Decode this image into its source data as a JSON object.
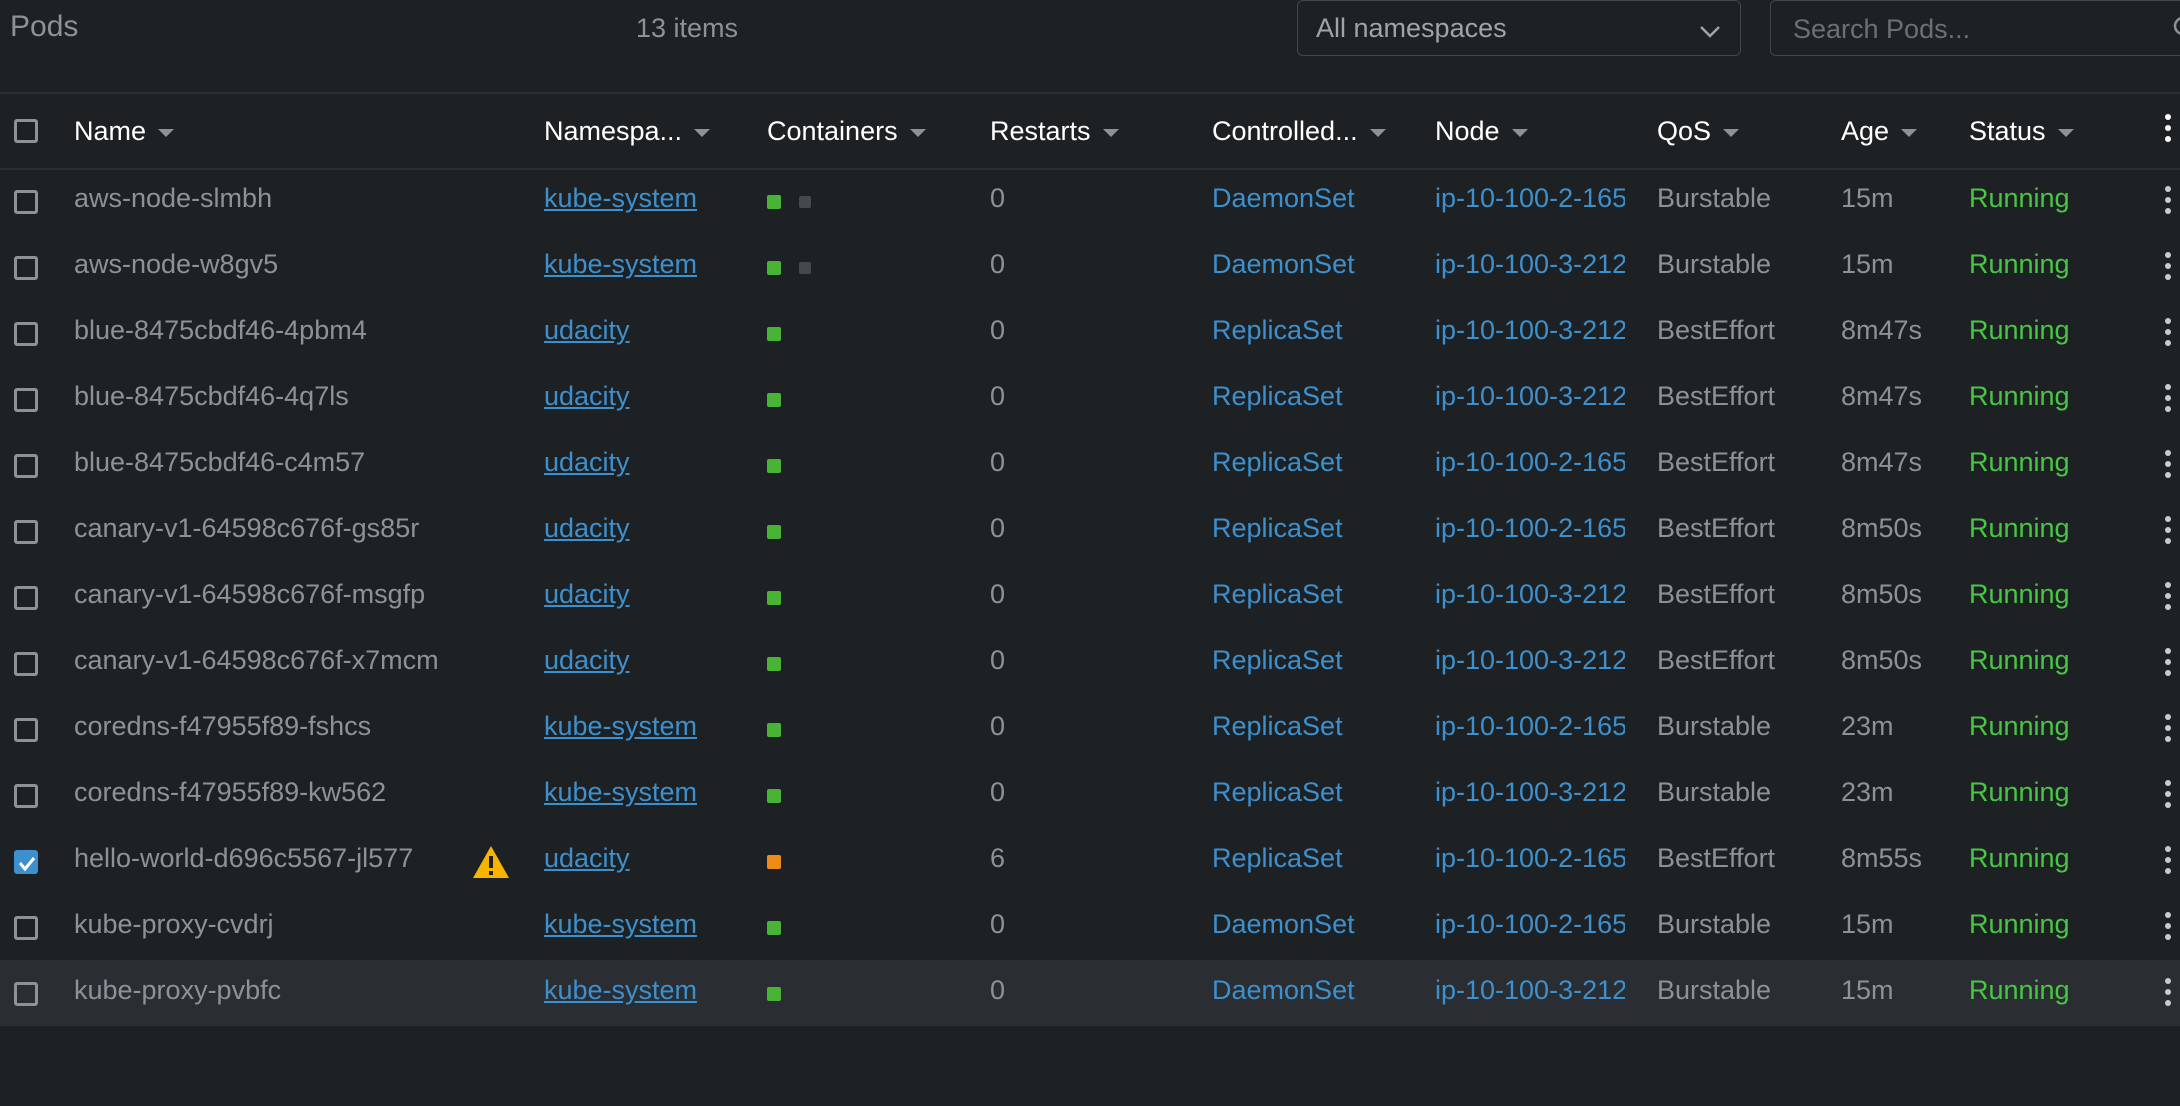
{
  "header": {
    "title": "Pods",
    "items_count": "13 items",
    "namespace_select": "All namespaces",
    "search_placeholder": "Search Pods..."
  },
  "columns": [
    "Name",
    "Namespa...",
    "Containers",
    "Restarts",
    "Controlled...",
    "Node",
    "QoS",
    "Age",
    "Status"
  ],
  "colors": {
    "background": "#1e2124",
    "link": "#3d90ce",
    "running": "#48c744",
    "container_ok": "#48b335",
    "container_gray": "#45494e",
    "container_warn": "#f18a17",
    "warning_icon": "#f7b500"
  },
  "rows": [
    {
      "name": "aws-node-slmbh",
      "namespace": "kube-system",
      "containers": [
        "green",
        "gray"
      ],
      "restarts": "0",
      "controlled_by": "DaemonSet",
      "node": "ip-10-100-2-165",
      "qos": "Burstable",
      "age": "15m",
      "status": "Running",
      "checked": false,
      "warning": false
    },
    {
      "name": "aws-node-w8gv5",
      "namespace": "kube-system",
      "containers": [
        "green",
        "gray"
      ],
      "restarts": "0",
      "controlled_by": "DaemonSet",
      "node": "ip-10-100-3-212",
      "qos": "Burstable",
      "age": "15m",
      "status": "Running",
      "checked": false,
      "warning": false
    },
    {
      "name": "blue-8475cbdf46-4pbm4",
      "namespace": "udacity",
      "containers": [
        "green"
      ],
      "restarts": "0",
      "controlled_by": "ReplicaSet",
      "node": "ip-10-100-3-212",
      "qos": "BestEffort",
      "age": "8m47s",
      "status": "Running",
      "checked": false,
      "warning": false
    },
    {
      "name": "blue-8475cbdf46-4q7ls",
      "namespace": "udacity",
      "containers": [
        "green"
      ],
      "restarts": "0",
      "controlled_by": "ReplicaSet",
      "node": "ip-10-100-3-212",
      "qos": "BestEffort",
      "age": "8m47s",
      "status": "Running",
      "checked": false,
      "warning": false
    },
    {
      "name": "blue-8475cbdf46-c4m57",
      "namespace": "udacity",
      "containers": [
        "green"
      ],
      "restarts": "0",
      "controlled_by": "ReplicaSet",
      "node": "ip-10-100-2-165",
      "qos": "BestEffort",
      "age": "8m47s",
      "status": "Running",
      "checked": false,
      "warning": false
    },
    {
      "name": "canary-v1-64598c676f-gs85r",
      "namespace": "udacity",
      "containers": [
        "green"
      ],
      "restarts": "0",
      "controlled_by": "ReplicaSet",
      "node": "ip-10-100-2-165",
      "qos": "BestEffort",
      "age": "8m50s",
      "status": "Running",
      "checked": false,
      "warning": false
    },
    {
      "name": "canary-v1-64598c676f-msgfp",
      "namespace": "udacity",
      "containers": [
        "green"
      ],
      "restarts": "0",
      "controlled_by": "ReplicaSet",
      "node": "ip-10-100-3-212",
      "qos": "BestEffort",
      "age": "8m50s",
      "status": "Running",
      "checked": false,
      "warning": false
    },
    {
      "name": "canary-v1-64598c676f-x7mcm",
      "namespace": "udacity",
      "containers": [
        "green"
      ],
      "restarts": "0",
      "controlled_by": "ReplicaSet",
      "node": "ip-10-100-3-212",
      "qos": "BestEffort",
      "age": "8m50s",
      "status": "Running",
      "checked": false,
      "warning": false
    },
    {
      "name": "coredns-f47955f89-fshcs",
      "namespace": "kube-system",
      "containers": [
        "green"
      ],
      "restarts": "0",
      "controlled_by": "ReplicaSet",
      "node": "ip-10-100-2-165",
      "qos": "Burstable",
      "age": "23m",
      "status": "Running",
      "checked": false,
      "warning": false
    },
    {
      "name": "coredns-f47955f89-kw562",
      "namespace": "kube-system",
      "containers": [
        "green"
      ],
      "restarts": "0",
      "controlled_by": "ReplicaSet",
      "node": "ip-10-100-3-212",
      "qos": "Burstable",
      "age": "23m",
      "status": "Running",
      "checked": false,
      "warning": false
    },
    {
      "name": "hello-world-d696c5567-jl577",
      "namespace": "udacity",
      "containers": [
        "orange"
      ],
      "restarts": "6",
      "controlled_by": "ReplicaSet",
      "node": "ip-10-100-2-165",
      "qos": "BestEffort",
      "age": "8m55s",
      "status": "Running",
      "checked": true,
      "warning": true
    },
    {
      "name": "kube-proxy-cvdrj",
      "namespace": "kube-system",
      "containers": [
        "green"
      ],
      "restarts": "0",
      "controlled_by": "DaemonSet",
      "node": "ip-10-100-2-165",
      "qos": "Burstable",
      "age": "15m",
      "status": "Running",
      "checked": false,
      "warning": false
    },
    {
      "name": "kube-proxy-pvbfc",
      "namespace": "kube-system",
      "containers": [
        "green"
      ],
      "restarts": "0",
      "controlled_by": "DaemonSet",
      "node": "ip-10-100-3-212",
      "qos": "Burstable",
      "age": "15m",
      "status": "Running",
      "checked": false,
      "warning": false,
      "hovered": true
    }
  ]
}
